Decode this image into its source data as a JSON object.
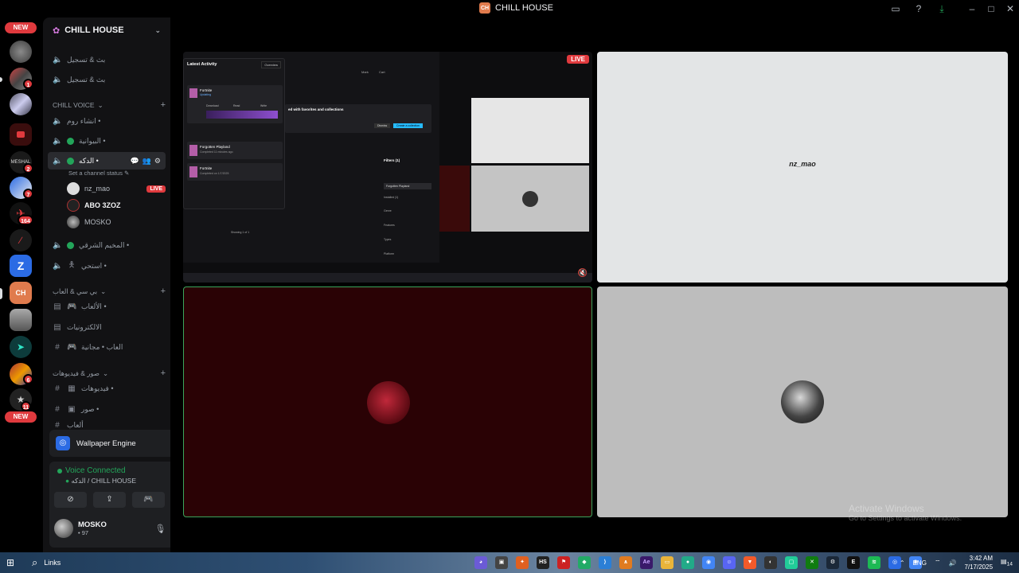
{
  "app": {
    "title": "CHILL HOUSE",
    "logo_text": "CH"
  },
  "rail": {
    "new_label": "NEW",
    "badges": [
      "1",
      "2",
      "7",
      "164",
      "6",
      "11"
    ],
    "meshal_label": "MESHAL"
  },
  "sidebar": {
    "server_name": "CHILL HOUSE",
    "top_channels": [
      "بث & تسجيل",
      "بث & تسجيل"
    ],
    "categories": {
      "chill_voice": "CHILL VOICE",
      "pc_games": "بي سي & العاب",
      "media": "صور & فيديوهات"
    },
    "voice_channels": [
      {
        "name": "انشاء روم •"
      },
      {
        "name": "البيوانية •"
      },
      {
        "name": "الدكه •",
        "status": "Set a channel status"
      },
      {
        "name": "المخيم الشرقي •"
      },
      {
        "name": "استحي •"
      }
    ],
    "voice_users": [
      {
        "name": "nz_mao",
        "live": "LIVE"
      },
      {
        "name": "ABO 3ZOZ"
      },
      {
        "name": "MOSKO"
      }
    ],
    "forum_channels": [
      "الألعاب •",
      "الالكترونيات",
      "العاب • مجانية"
    ],
    "media_channels": [
      "فيديوهات •",
      "صور •",
      "ألعاب"
    ]
  },
  "wallpaper": {
    "label": "Wallpaper Engine"
  },
  "voice": {
    "status": "Voice Connected",
    "location": "الدكه / CHILL HOUSE"
  },
  "user": {
    "name": "MOSKO",
    "status": "• 97"
  },
  "stage": {
    "live_label": "LIVE",
    "screen": {
      "latest_activity": "Latest Activity",
      "overview": "Overview",
      "items": [
        {
          "title": "Fortnite",
          "sub": "Updating"
        },
        {
          "title": "Forgotten Playland",
          "sub": "Completed 11 minutes ago"
        },
        {
          "title": "Fortnite",
          "sub": "Completed on 1/7/2025"
        }
      ],
      "download_label": "Download",
      "read_label": "Read",
      "write_label": "Write",
      "collections_text": "ed with favorites and collections",
      "dismiss": "Dismiss",
      "create_collection": "Create a collection",
      "filters": "Filters (1)",
      "filter_value": "Forgotten Playland",
      "filter_rows": [
        "Installed (1)",
        "Genre",
        "Features",
        "Types",
        "Platform"
      ],
      "showing": "Showing 1 of 1",
      "mark": "Mark",
      "cart": "Cart"
    },
    "tile2_name": "nz_mao"
  },
  "watermark": {
    "line1": "Activate Windows",
    "line2": "Go to Settings to activate Windows."
  },
  "taskbar": {
    "search": "Links",
    "lang": "ENG",
    "time": "3:42 AM",
    "date": "7/17/2025",
    "notif": "14"
  }
}
